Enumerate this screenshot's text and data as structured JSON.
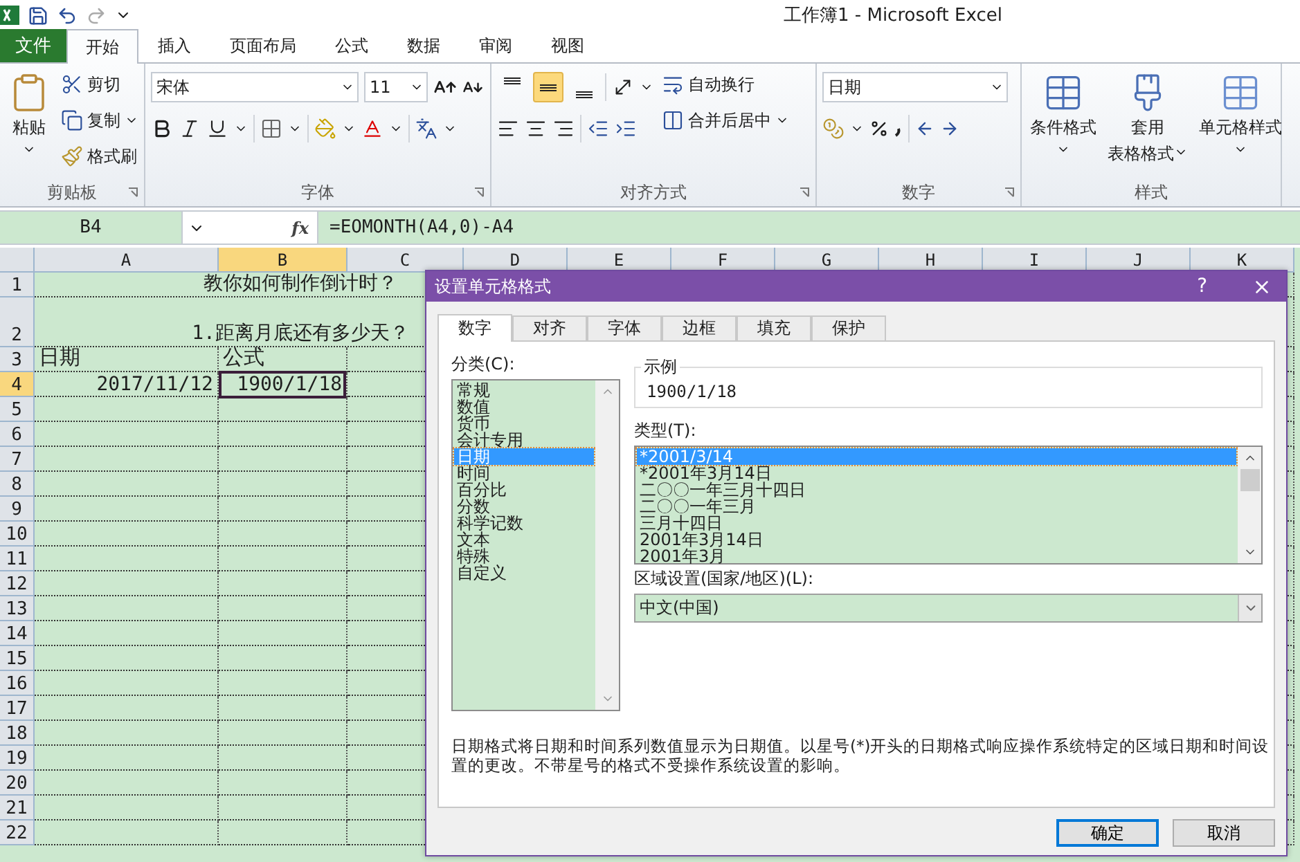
{
  "window": {
    "title": "工作簿1  -  Microsoft Excel"
  },
  "file_tab": "文件",
  "tabs": [
    {
      "label": "开始",
      "selected": true
    },
    {
      "label": "插入",
      "selected": false
    },
    {
      "label": "页面布局",
      "selected": false
    },
    {
      "label": "公式",
      "selected": false
    },
    {
      "label": "数据",
      "selected": false
    },
    {
      "label": "审阅",
      "selected": false
    },
    {
      "label": "视图",
      "selected": false
    }
  ],
  "ribbon": {
    "clipboard": {
      "title": "剪贴板",
      "paste": "粘贴",
      "cut": "剪切",
      "copy": "复制",
      "format_painter": "格式刷"
    },
    "font": {
      "title": "字体",
      "font_name": "宋体",
      "font_size": "11"
    },
    "alignment": {
      "title": "对齐方式",
      "vertical": [
        {
          "kind": "top",
          "selected": false
        },
        {
          "kind": "middle",
          "selected": true
        },
        {
          "kind": "bottom",
          "selected": false
        }
      ],
      "wrap_text": "自动换行",
      "merge_center": "合并后居中"
    },
    "number": {
      "title": "数字",
      "format": "日期"
    },
    "styles": {
      "title": "样式",
      "conditional": "条件格式",
      "table_format": [
        "套用",
        "表格格式"
      ],
      "cell_styles": "单元格样式"
    }
  },
  "formula_bar": {
    "name_box": "B4",
    "fx": "fx",
    "formula": "=EOMONTH(A4,0)-A4"
  },
  "sheet": {
    "columns": [
      {
        "label": "A",
        "selected": false
      },
      {
        "label": "B",
        "selected": true
      },
      {
        "label": "C",
        "selected": false
      },
      {
        "label": "D",
        "selected": false
      },
      {
        "label": "E",
        "selected": false
      },
      {
        "label": "F",
        "selected": false
      },
      {
        "label": "G",
        "selected": false
      },
      {
        "label": "H",
        "selected": false
      },
      {
        "label": "I",
        "selected": false
      },
      {
        "label": "J",
        "selected": false
      },
      {
        "label": "K",
        "selected": false
      }
    ],
    "rows": [
      {
        "label": "1",
        "selected": false,
        "A": {
          "text": "教你如何制作倒计时？",
          "kind": "merged",
          "selected": false
        }
      },
      {
        "label": "2",
        "selected": false,
        "A": {
          "text": "1.距离月底还有多少天？",
          "kind": "merged",
          "selected": false
        }
      },
      {
        "label": "3",
        "selected": false,
        "A": {
          "text": "日期",
          "kind": "heading",
          "selected": false
        },
        "B": {
          "text": "公式",
          "kind": "heading",
          "selected": false
        }
      },
      {
        "label": "4",
        "selected": true,
        "A": {
          "text": "2017/11/12",
          "kind": "date",
          "selected": false
        },
        "B": {
          "text": "1900/1/18",
          "kind": "date",
          "selected": true
        }
      },
      {
        "label": "5",
        "selected": false
      },
      {
        "label": "6",
        "selected": false
      },
      {
        "label": "7",
        "selected": false
      },
      {
        "label": "8",
        "selected": false
      },
      {
        "label": "9",
        "selected": false
      },
      {
        "label": "10",
        "selected": false
      },
      {
        "label": "11",
        "selected": false
      },
      {
        "label": "12",
        "selected": false
      },
      {
        "label": "13",
        "selected": false
      },
      {
        "label": "14",
        "selected": false
      },
      {
        "label": "15",
        "selected": false
      },
      {
        "label": "16",
        "selected": false
      },
      {
        "label": "17",
        "selected": false
      },
      {
        "label": "18",
        "selected": false
      },
      {
        "label": "19",
        "selected": false
      },
      {
        "label": "20",
        "selected": false
      },
      {
        "label": "21",
        "selected": false
      },
      {
        "label": "22",
        "selected": false
      }
    ]
  },
  "dialog": {
    "title": "设置单元格格式",
    "help": "?",
    "tabs": [
      {
        "label": "数字",
        "selected": true
      },
      {
        "label": "对齐",
        "selected": false
      },
      {
        "label": "字体",
        "selected": false
      },
      {
        "label": "边框",
        "selected": false
      },
      {
        "label": "填充",
        "selected": false
      },
      {
        "label": "保护",
        "selected": false
      }
    ],
    "category_label": "分类(C):",
    "categories": [
      {
        "label": "常规",
        "selected": false
      },
      {
        "label": "数值",
        "selected": false
      },
      {
        "label": "货币",
        "selected": false
      },
      {
        "label": "会计专用",
        "selected": false
      },
      {
        "label": "日期",
        "selected": true
      },
      {
        "label": "时间",
        "selected": false
      },
      {
        "label": "百分比",
        "selected": false
      },
      {
        "label": "分数",
        "selected": false
      },
      {
        "label": "科学记数",
        "selected": false
      },
      {
        "label": "文本",
        "selected": false
      },
      {
        "label": "特殊",
        "selected": false
      },
      {
        "label": "自定义",
        "selected": false
      }
    ],
    "sample": {
      "label": "示例",
      "value": "1900/1/18"
    },
    "type_label": "类型(T):",
    "types": [
      {
        "label": "*2001/3/14",
        "selected": true
      },
      {
        "label": "*2001年3月14日",
        "selected": false
      },
      {
        "label": "二〇〇一年三月十四日",
        "selected": false
      },
      {
        "label": "二〇〇一年三月",
        "selected": false
      },
      {
        "label": "三月十四日",
        "selected": false
      },
      {
        "label": "2001年3月14日",
        "selected": false
      },
      {
        "label": "2001年3月",
        "selected": false
      }
    ],
    "locale_label": "区域设置(国家/地区)(L):",
    "locale": "中文(中国)",
    "description": "日期格式将日期和时间系列数值显示为日期值。以星号(*)开头的日期格式响应操作系统特定的区域日期和时间设置的更改。不带星号的格式不受操作系统设置的影响。",
    "buttons": [
      {
        "label": "确定",
        "kind": "primary"
      },
      {
        "label": "取消",
        "kind": "normal"
      }
    ]
  }
}
